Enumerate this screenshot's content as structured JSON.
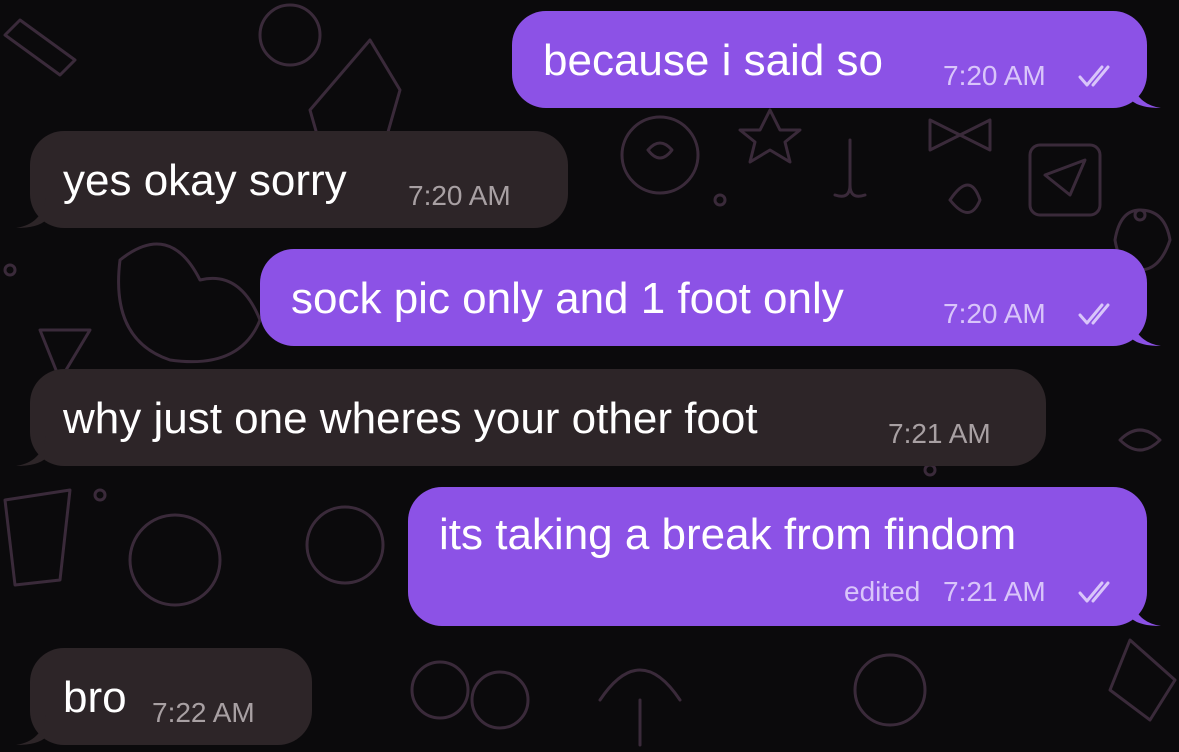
{
  "messages": [
    {
      "direction": "outgoing",
      "text": "because i said so",
      "time": "7:20 AM",
      "status_icon": "double-check-icon"
    },
    {
      "direction": "incoming",
      "text": "yes okay sorry",
      "time": "7:20 AM"
    },
    {
      "direction": "outgoing",
      "text": "sock pic only and 1 foot only",
      "time": "7:20 AM",
      "status_icon": "double-check-icon"
    },
    {
      "direction": "incoming",
      "text": "why just one wheres your other foot",
      "time": "7:21 AM"
    },
    {
      "direction": "outgoing",
      "text": "its taking a break from findom",
      "edited_label": "edited",
      "time": "7:21 AM",
      "status_icon": "double-check-icon"
    },
    {
      "direction": "incoming",
      "text": "bro",
      "time": "7:22 AM"
    }
  ],
  "colors": {
    "background": "#0b0a0c",
    "outgoing_bubble": "#8c52e6",
    "incoming_bubble": "#2d2528",
    "doodle_lines": "#3a2a3a"
  }
}
